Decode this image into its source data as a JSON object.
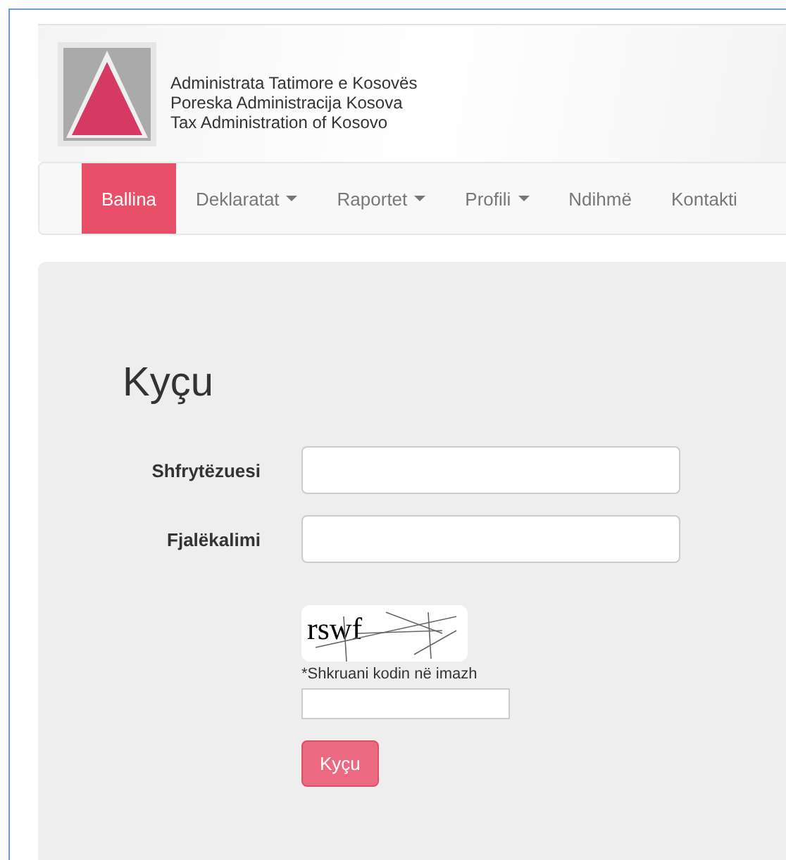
{
  "header": {
    "lines": [
      "Administrata Tatimore e Kosovës",
      "Poreska Administracija Kosova",
      "Tax Administration of Kosovo"
    ]
  },
  "nav": [
    {
      "label": "Ballina",
      "selected": true,
      "dropdown": false
    },
    {
      "label": "Deklaratat",
      "selected": false,
      "dropdown": true
    },
    {
      "label": "Raportet",
      "selected": false,
      "dropdown": true
    },
    {
      "label": "Profili",
      "selected": false,
      "dropdown": true
    },
    {
      "label": "Ndihmë",
      "selected": false,
      "dropdown": false
    },
    {
      "label": "Kontakti",
      "selected": false,
      "dropdown": false
    }
  ],
  "login": {
    "title": "Kyçu",
    "fields": [
      {
        "label": "Shfrytëzuesi"
      },
      {
        "label": "Fjalëkalimi"
      }
    ],
    "captcha": {
      "code": "rswf",
      "hint": "*Shkruani kodin në imazh"
    },
    "button": "Kyçu"
  }
}
